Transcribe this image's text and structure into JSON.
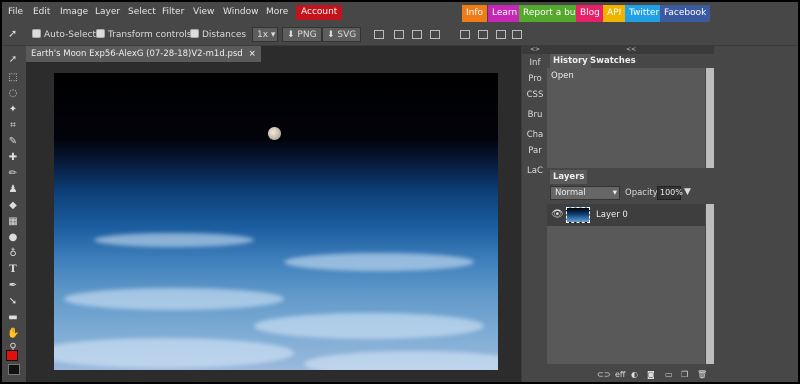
{
  "menu": [
    "File",
    "Edit",
    "Image",
    "Layer",
    "Select",
    "Filter",
    "View",
    "Window",
    "More"
  ],
  "account_label": "Account",
  "external_links": [
    {
      "label": "Info",
      "color": "#f07c18"
    },
    {
      "label": "Learn",
      "color": "#c428b4"
    },
    {
      "label": "Report a bug",
      "color": "#54a82c"
    },
    {
      "label": "Blog",
      "color": "#e8206a"
    },
    {
      "label": "API",
      "color": "#f0b400"
    },
    {
      "label": "Twitter",
      "color": "#22a0e6"
    },
    {
      "label": "Facebook",
      "color": "#3b5aa0"
    }
  ],
  "options": {
    "auto_select": "Auto-Select",
    "transform_controls": "Transform controls",
    "distances": "Distances",
    "scale": "1x",
    "png": "PNG",
    "svg": "SVG"
  },
  "document": {
    "tab_title": "Earth's Moon Exp56-AlexG (07-28-18)V2-m1d.psd",
    "close": "×"
  },
  "mini_panel": {
    "collapse": "<>",
    "items": [
      "Inf",
      "Pro",
      "CSS",
      "Bru",
      "Cha",
      "Par",
      "LaC"
    ]
  },
  "history_panel": {
    "collapse": "<<",
    "tabs": [
      "History",
      "Swatches"
    ],
    "items": [
      "Open"
    ]
  },
  "layers_panel": {
    "tab": "Layers",
    "blend_mode": "Normal",
    "opacity_label": "Opacity:",
    "opacity_value": "100%",
    "layers": [
      {
        "name": "Layer 0"
      }
    ],
    "footer_link_label": "eff"
  },
  "colors": {
    "foreground": "#e30e0e",
    "background": "#111111",
    "accent_account": "#c4141b"
  }
}
